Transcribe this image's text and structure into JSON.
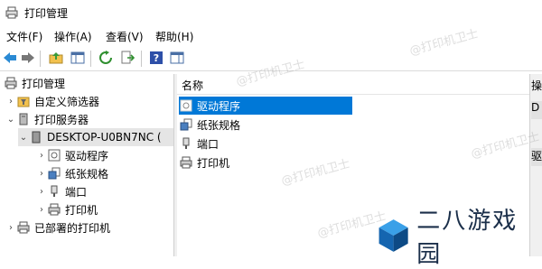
{
  "window": {
    "title": "打印管理"
  },
  "menu": [
    "文件(F)",
    "操作(A)",
    "查看(V)",
    "帮助(H)"
  ],
  "tree": {
    "root": "打印管理",
    "custom_filters": "自定义筛选器",
    "print_servers": "打印服务器",
    "server": "DESKTOP-U0BN7NC (",
    "drivers": "驱动程序",
    "forms": "纸张规格",
    "ports": "端口",
    "printers": "打印机",
    "deployed": "已部署的打印机"
  },
  "list": {
    "header": "名称",
    "items": [
      "驱动程序",
      "纸张规格",
      "端口",
      "打印机"
    ],
    "selected_index": 0
  },
  "actions": {
    "header": "操",
    "items": [
      "D",
      "驱"
    ]
  },
  "watermark": "@打印机卫士",
  "brand": {
    "text": "二八游戏园"
  },
  "colors": {
    "selection": "#0078d7",
    "accent": "#0a7fd8"
  }
}
